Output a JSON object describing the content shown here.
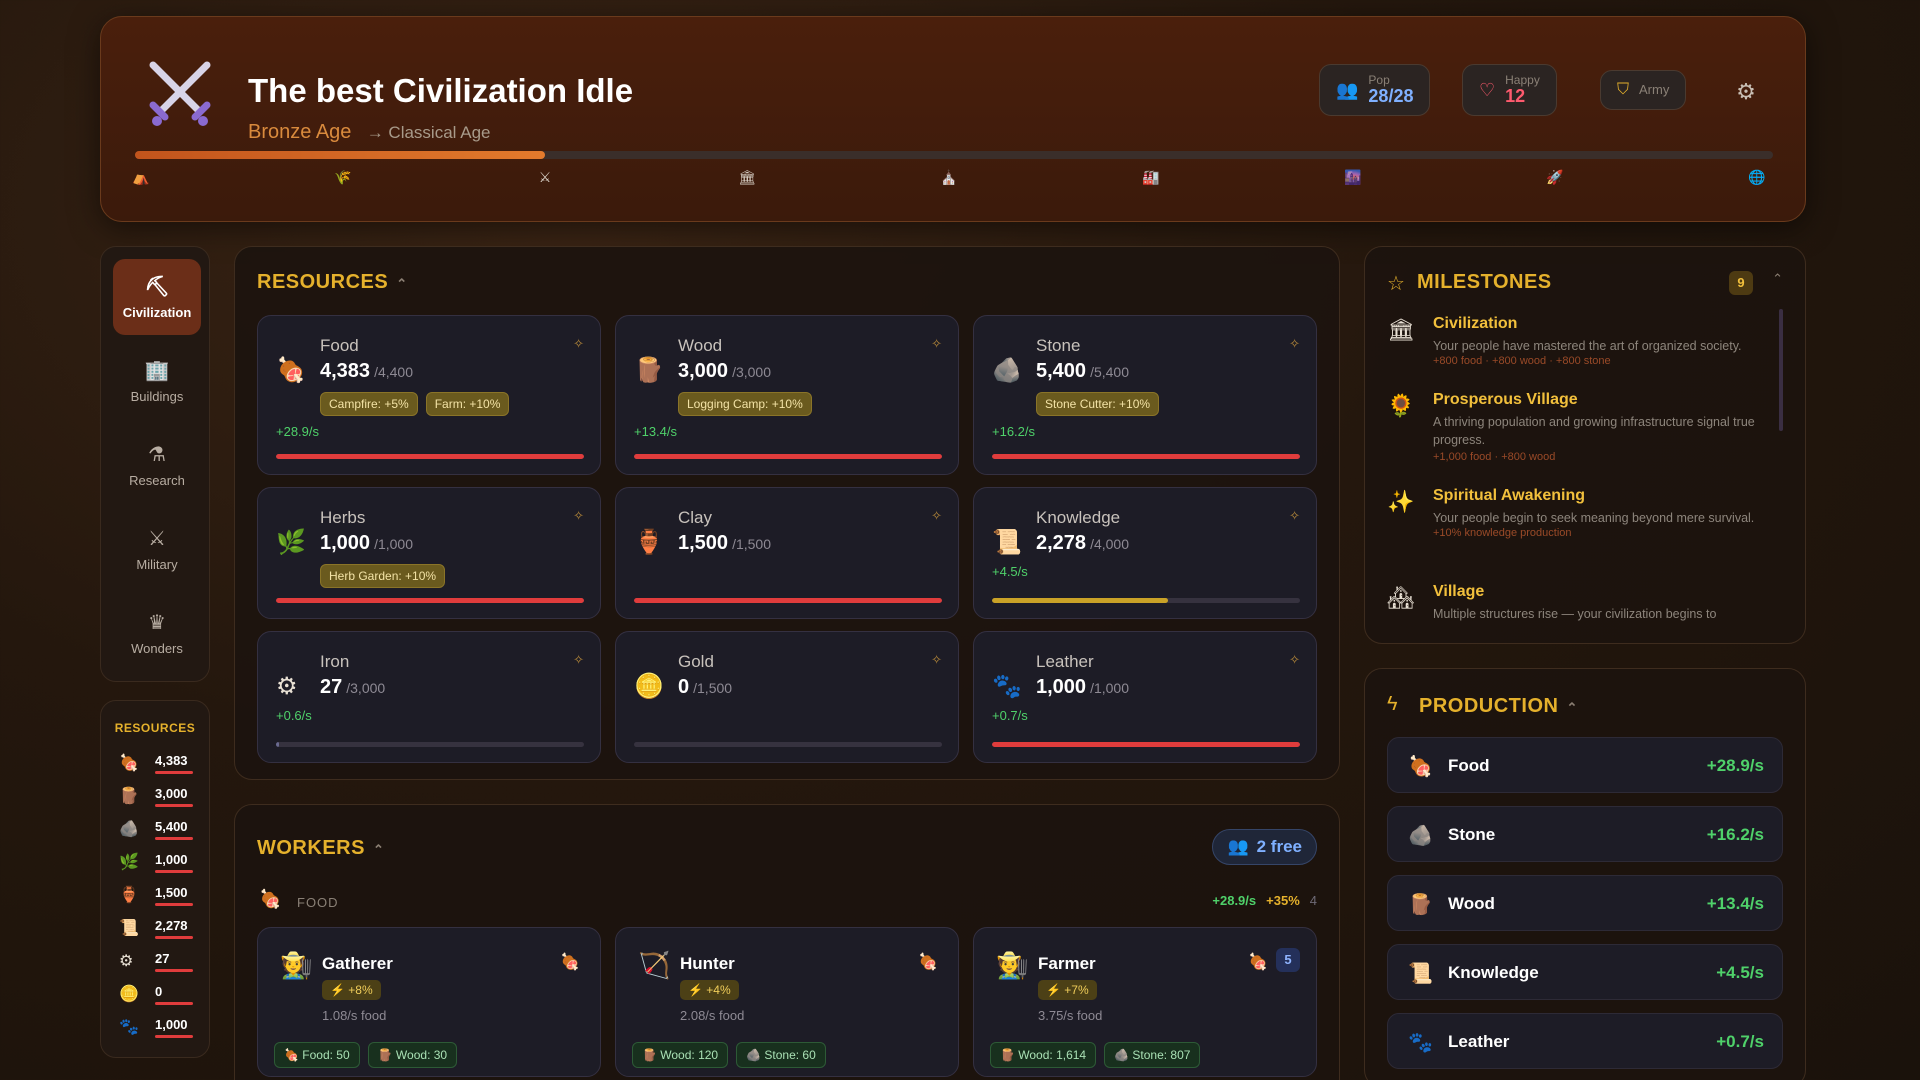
{
  "header": {
    "title": "The best Civilization Idle",
    "current_age": "Bronze Age",
    "next_age": "→ Classical Age",
    "pop_label": "Pop",
    "pop_value": "28/28",
    "happy_label": "Happy",
    "happy_value": "12",
    "army_label": "Army",
    "age_progress_percent": 25,
    "era_markers": [
      "⛺",
      "🌾",
      "⚔",
      "🏛",
      "⛪",
      "🏭",
      "🌆",
      "🚀",
      "🌐"
    ]
  },
  "nav": {
    "items": [
      {
        "label": "Civilization",
        "icon": "⛏"
      },
      {
        "label": "Buildings",
        "icon": "🏢"
      },
      {
        "label": "Research",
        "icon": "⚗"
      },
      {
        "label": "Military",
        "icon": "⚔"
      },
      {
        "label": "Wonders",
        "icon": "♛"
      }
    ]
  },
  "mini_resources": {
    "title": "RESOURCES",
    "items": [
      {
        "icon": "🍖",
        "value": "4,383"
      },
      {
        "icon": "🪵",
        "value": "3,000"
      },
      {
        "icon": "🪨",
        "value": "5,400"
      },
      {
        "icon": "🌿",
        "value": "1,000"
      },
      {
        "icon": "🏺",
        "value": "1,500"
      },
      {
        "icon": "📜",
        "value": "2,278"
      },
      {
        "icon": "⚙",
        "value": "27"
      },
      {
        "icon": "🪙",
        "value": "0"
      },
      {
        "icon": "🐾",
        "value": "1,000"
      }
    ]
  },
  "resources": {
    "title": "RESOURCES",
    "cards": [
      {
        "name": "Food",
        "icon": "🍖",
        "amount": "4,383",
        "cap": "/4,400",
        "bonuses": [
          "Campfire: +5%",
          "Farm: +10%"
        ],
        "rate": "+28.9/s",
        "fill": 1.0,
        "color": "#e03c3c"
      },
      {
        "name": "Wood",
        "icon": "🪵",
        "amount": "3,000",
        "cap": "/3,000",
        "bonuses": [
          "Logging Camp: +10%"
        ],
        "rate": "+13.4/s",
        "fill": 1.0,
        "color": "#e03c3c"
      },
      {
        "name": "Stone",
        "icon": "🪨",
        "amount": "5,400",
        "cap": "/5,400",
        "bonuses": [
          "Stone Cutter: +10%"
        ],
        "rate": "+16.2/s",
        "fill": 1.0,
        "color": "#e03c3c"
      },
      {
        "name": "Herbs",
        "icon": "🌿",
        "amount": "1,000",
        "cap": "/1,000",
        "bonuses": [
          "Herb Garden: +10%"
        ],
        "rate": "",
        "fill": 1.0,
        "color": "#e03c3c"
      },
      {
        "name": "Clay",
        "icon": "🏺",
        "amount": "1,500",
        "cap": "/1,500",
        "bonuses": [],
        "rate": "",
        "fill": 1.0,
        "color": "#e03c3c"
      },
      {
        "name": "Knowledge",
        "icon": "📜",
        "amount": "2,278",
        "cap": "/4,000",
        "bonuses": [],
        "rate": "+4.5/s",
        "fill": 0.57,
        "color": "#c9a227"
      },
      {
        "name": "Iron",
        "icon": "⚙",
        "amount": "27",
        "cap": "/3,000",
        "bonuses": [],
        "rate": "+0.6/s",
        "fill": 0.01,
        "color": "#6a6a90"
      },
      {
        "name": "Gold",
        "icon": "🪙",
        "amount": "0",
        "cap": "/1,500",
        "bonuses": [],
        "rate": "",
        "fill": 0.0,
        "color": "#6a6a90"
      },
      {
        "name": "Leather",
        "icon": "🐾",
        "amount": "1,000",
        "cap": "/1,000",
        "bonuses": [],
        "rate": "+0.7/s",
        "fill": 1.0,
        "color": "#e03c3c"
      }
    ]
  },
  "workers": {
    "title": "WORKERS",
    "free": "2 free",
    "group_label": "FOOD",
    "group_rate": "+28.9/s",
    "group_bonus": "+35%",
    "group_count": "4",
    "cards": [
      {
        "name": "Gatherer",
        "icon": "🧑‍🌾",
        "bonus": "⚡ +8%",
        "rate": "1.08/s food",
        "count": "",
        "costs": [
          "🍖 Food: 50",
          "🪵 Wood: 30"
        ]
      },
      {
        "name": "Hunter",
        "icon": "🏹",
        "bonus": "⚡ +4%",
        "rate": "2.08/s food",
        "count": "",
        "costs": [
          "🪵 Wood: 120",
          "🪨 Stone: 60"
        ]
      },
      {
        "name": "Farmer",
        "icon": "🧑‍🌾",
        "bonus": "⚡ +7%",
        "rate": "3.75/s food",
        "count": "5",
        "costs": [
          "🪵 Wood: 1,614",
          "🪨 Stone: 807"
        ]
      }
    ]
  },
  "milestones": {
    "title": "MILESTONES",
    "count": "9",
    "items": [
      {
        "icon": "🏛",
        "title": "Civilization",
        "desc": "Your people have mastered the art of organized society.",
        "reward": "+800 food · +800 wood · +800 stone"
      },
      {
        "icon": "🌻",
        "title": "Prosperous Village",
        "desc": "A thriving population and growing infrastructure signal true progress.",
        "reward": "+1,000 food · +800 wood"
      },
      {
        "icon": "✨",
        "title": "Spiritual Awakening",
        "desc": "Your people begin to seek meaning beyond mere survival.",
        "reward": "+10% knowledge production"
      },
      {
        "icon": "🏘",
        "title": "Village",
        "desc": "Multiple structures rise — your civilization begins to",
        "reward": ""
      }
    ]
  },
  "production": {
    "title": "PRODUCTION",
    "items": [
      {
        "icon": "🍖",
        "name": "Food",
        "rate": "+28.9/s"
      },
      {
        "icon": "🪨",
        "name": "Stone",
        "rate": "+16.2/s"
      },
      {
        "icon": "🪵",
        "name": "Wood",
        "rate": "+13.4/s"
      },
      {
        "icon": "📜",
        "name": "Knowledge",
        "rate": "+4.5/s"
      },
      {
        "icon": "🐾",
        "name": "Leather",
        "rate": "+0.7/s"
      }
    ]
  },
  "colors": {
    "accent": "#e5b12c",
    "progress": "#e37a2c",
    "positive": "#4fd16a",
    "danger": "#e03c3c"
  }
}
